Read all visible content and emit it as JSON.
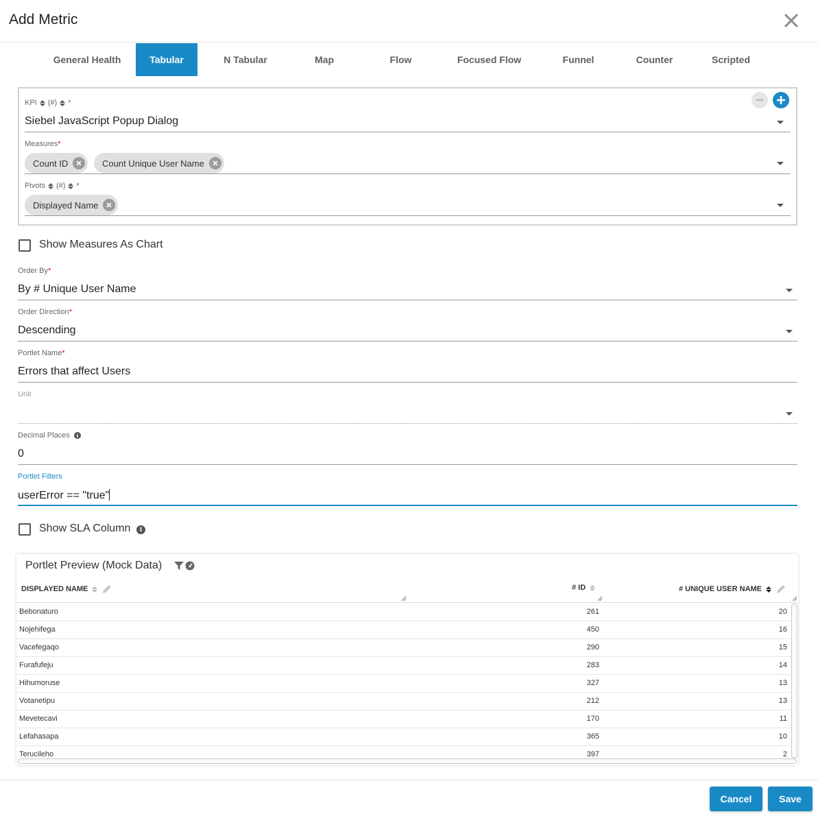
{
  "dialog": {
    "title": "Add Metric"
  },
  "tabs": [
    {
      "label": "General Health"
    },
    {
      "label": "Tabular",
      "active": true
    },
    {
      "label": "N Tabular"
    },
    {
      "label": "Map"
    },
    {
      "label": "Flow"
    },
    {
      "label": "Focused Flow"
    },
    {
      "label": "Funnel"
    },
    {
      "label": "Counter"
    },
    {
      "label": "Scripted"
    }
  ],
  "kpi_group": {
    "kpi": {
      "label": "KPI",
      "count_label": "(#)",
      "required_mark": "*",
      "value": "Siebel JavaScript Popup Dialog"
    },
    "measures": {
      "label": "Measures",
      "required_mark": "*",
      "chips": [
        "Count ID",
        "Count Unique User Name"
      ]
    },
    "pivots": {
      "label": "Pivots",
      "count_label": "(#)",
      "required_mark": "*",
      "chips": [
        "Displayed Name"
      ]
    }
  },
  "form": {
    "show_measures_as_chart": {
      "label": "Show Measures As Chart",
      "checked": false
    },
    "order_by": {
      "label": "Order By",
      "required_mark": "*",
      "value": "By # Unique User Name"
    },
    "order_direction": {
      "label": "Order Direction",
      "required_mark": "*",
      "value": "Descending"
    },
    "portlet_name": {
      "label": "Portlet Name",
      "required_mark": "*",
      "value": "Errors that affect Users"
    },
    "unit": {
      "label": "Unit",
      "value": ""
    },
    "decimal_places": {
      "label": "Decimal Places",
      "value": "0"
    },
    "portlet_filters": {
      "label": "Portlet Filters",
      "value": "userError == \"true\""
    },
    "show_sla_column": {
      "label": "Show SLA Column",
      "checked": false
    }
  },
  "preview": {
    "title": "Portlet Preview (Mock Data)",
    "columns": [
      "DISPLAYED NAME",
      "# ID",
      "# UNIQUE USER NAME"
    ],
    "rows": [
      {
        "name": "Bebonaturo",
        "id": "261",
        "users": "20"
      },
      {
        "name": "Nojehifega",
        "id": "450",
        "users": "16"
      },
      {
        "name": "Vacefegaqo",
        "id": "290",
        "users": "15"
      },
      {
        "name": "Furafufeju",
        "id": "283",
        "users": "14"
      },
      {
        "name": "Hihumoruse",
        "id": "327",
        "users": "13"
      },
      {
        "name": "Votanetipu",
        "id": "212",
        "users": "13"
      },
      {
        "name": "Mevetecavi",
        "id": "170",
        "users": "11"
      },
      {
        "name": "Lefahasapa",
        "id": "365",
        "users": "10"
      },
      {
        "name": "Terucileho",
        "id": "397",
        "users": "2"
      }
    ]
  },
  "footer": {
    "cancel_label": "Cancel",
    "save_label": "Save"
  },
  "colors": {
    "accent": "#1a8ac6",
    "required": "#d0021b",
    "chip": "#e0e0e0"
  }
}
